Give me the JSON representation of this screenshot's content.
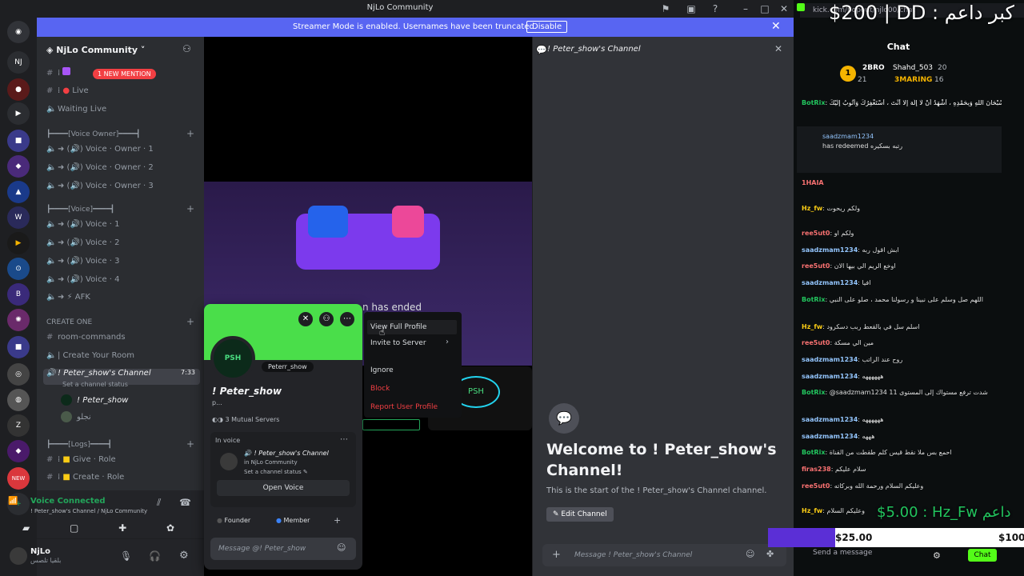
{
  "window": {
    "title": "NjLo Community"
  },
  "banner": {
    "text": "Streamer Mode is enabled. Usernames have been truncated.",
    "button": "Disable"
  },
  "sidebar": {
    "guild_name": "NjLo Community",
    "mention_badge": "1 NEW MENTION",
    "items": [
      {
        "label": "Live"
      },
      {
        "label": "Waiting Live"
      },
      {
        "label": "┣━━━━[Voice Owner]━━━━┫"
      },
      {
        "label": "Voice · Owner · 1"
      },
      {
        "label": "Voice · Owner · 2"
      },
      {
        "label": "Voice · Owner · 3"
      },
      {
        "label": "┣━━━━[Voice]━━━━┫"
      },
      {
        "label": "Voice · 1"
      },
      {
        "label": "Voice · 2"
      },
      {
        "label": "Voice · 3"
      },
      {
        "label": "Voice · 4"
      },
      {
        "label": "AFK"
      },
      {
        "label": "CREATE ONE"
      },
      {
        "label": "room-commands"
      },
      {
        "label": "| Create Your Room"
      },
      {
        "label": "! Peter_show's Channel"
      },
      {
        "label": "Set a channel status"
      },
      {
        "label": "! Peter_show"
      },
      {
        "label": "نجلو"
      },
      {
        "label": "┣━━━━[Logs]━━━━┫"
      },
      {
        "label": "Give · Role"
      },
      {
        "label": "Create · Role"
      }
    ],
    "voice_time": "7:33",
    "voice_connected": "Voice Connected",
    "voice_sub": "! Peter_show's Channel / NjLo Community",
    "user_name": "NjLo",
    "user_status": "بلقيا تلصس"
  },
  "center": {
    "ended_text": "n has ended"
  },
  "popout": {
    "handle": "Peterr_show",
    "display_name": "! Peter_show",
    "pronouns": "p...",
    "mutual": "3 Mutual Servers",
    "section": "In voice",
    "channel": "! Peter_show's Channel",
    "guild": "in NjLo Community",
    "channel_status": "Set a channel status",
    "open_voice": "Open Voice",
    "role1": "Founder",
    "role2": "Member",
    "message_placeholder": "Message @! Peter_show"
  },
  "context_menu": {
    "items": [
      "View Full Profile",
      "Invite to Server",
      "Ignore",
      "Block",
      "Report User Profile"
    ]
  },
  "chat_panel": {
    "title": "! Peter_show's Channel",
    "welcome": "Welcome to ! Peter_show's Channel!",
    "sub": "This is the start of the ! Peter_show's Channel channel.",
    "edit": "Edit Channel",
    "input_placeholder": "Message ! Peter_show's Channel"
  },
  "kick": {
    "url": "kick.com/popout/njlo00/chat",
    "chat_label": "Chat",
    "leaders": [
      "2BRO",
      "Shahd_503",
      "20",
      "21",
      "3MARING",
      "16"
    ],
    "messages": [
      {
        "user": "BotRix",
        "text": "سُبْحَانَ اللَّهِ وَبِحَمْدِهِ ، أَشْهَدُ أَنْ لَا إِلَهَ إِلَّا أَنْتَ ، أَسْتَغْفِرُكَ وَأَتُوبُ إِلَيْكَ"
      },
      {
        "user": "saadzmam1234",
        "text": "has redeemed رتبه بسكيره"
      },
      {
        "user": "1HAIA",
        "text": ""
      },
      {
        "user": "Hz_fw",
        "text": "ولكم ريحوت"
      },
      {
        "user": "ree5ut0",
        "text": "ولكم او"
      },
      {
        "user": "saadzmam1234",
        "text": "ابش اقول ربه"
      },
      {
        "user": "ree5ut0",
        "text": "اوخع الريم الي بيها الان"
      },
      {
        "user": "saadzmam1234",
        "text": "افيا"
      },
      {
        "user": "BotRix",
        "text": "اللهم صل وسلم على نبينا و رسولنا محمد ، صلو على النبي"
      },
      {
        "user": "Hz_fw",
        "text": "اسلم سل في بالقعط ربب دسكرود"
      },
      {
        "user": "ree5ut0",
        "text": "مين الي مسكة"
      },
      {
        "user": "saadzmam1234",
        "text": "روح عند الراتب"
      },
      {
        "user": "saadzmam1234",
        "text": "ههههههه"
      },
      {
        "user": "BotRix",
        "text": "@saadzmam1234 شدت ترفع مستواك إلى المستوى 11"
      },
      {
        "user": "saadzmam1234",
        "text": "ههههههه"
      },
      {
        "user": "saadzmam1234",
        "text": "هههه"
      },
      {
        "user": "BotRix",
        "text": "احمع بس ملا نقط قيس كلم طقطت من القناة"
      },
      {
        "user": "firas238",
        "text": "سلام عليكم"
      },
      {
        "user": "ree5ut0",
        "text": "وعليكم السلام ورحمة الله وبركاته"
      },
      {
        "user": "Hz_fw",
        "text": "وعليكم السلام"
      }
    ],
    "overlay_title": "$200 | DD : كبر داعم",
    "overlay_donor": "$5.00 : Hz_Fw داعم",
    "donation_bar": [
      "$25.00",
      "$100"
    ],
    "send_placeholder": "Send a message",
    "chat_button": "Chat"
  }
}
